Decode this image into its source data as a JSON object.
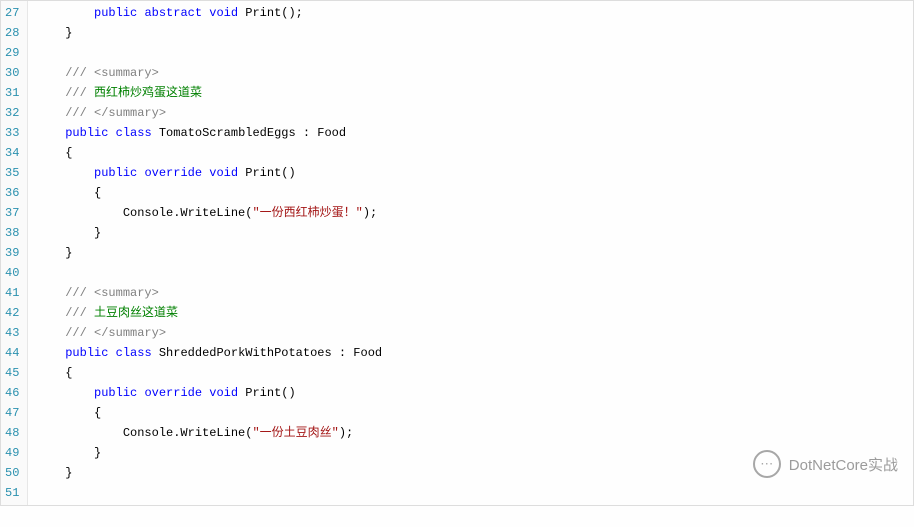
{
  "watermark": {
    "icon": "⋯",
    "text": "DotNetCore实战"
  },
  "lines": [
    {
      "n": 27,
      "segs": [
        {
          "t": "        "
        },
        {
          "t": "public",
          "c": "kw"
        },
        {
          "t": " "
        },
        {
          "t": "abstract",
          "c": "kw"
        },
        {
          "t": " "
        },
        {
          "t": "void",
          "c": "kw"
        },
        {
          "t": " Print();",
          "c": "txt"
        }
      ]
    },
    {
      "n": 28,
      "segs": [
        {
          "t": "    }",
          "c": "txt"
        }
      ]
    },
    {
      "n": 29,
      "segs": [
        {
          "t": " "
        }
      ]
    },
    {
      "n": 30,
      "segs": [
        {
          "t": "    "
        },
        {
          "t": "/// <summary>",
          "c": "com"
        }
      ]
    },
    {
      "n": 31,
      "segs": [
        {
          "t": "    "
        },
        {
          "t": "///",
          "c": "com"
        },
        {
          "t": " 西红柿炒鸡蛋这道菜",
          "c": "grn"
        }
      ]
    },
    {
      "n": 32,
      "segs": [
        {
          "t": "    "
        },
        {
          "t": "/// </summary>",
          "c": "com"
        }
      ]
    },
    {
      "n": 33,
      "segs": [
        {
          "t": "    "
        },
        {
          "t": "public",
          "c": "kw"
        },
        {
          "t": " "
        },
        {
          "t": "class",
          "c": "kw"
        },
        {
          "t": " TomatoScrambledEggs : Food",
          "c": "txt"
        }
      ]
    },
    {
      "n": 34,
      "segs": [
        {
          "t": "    {",
          "c": "txt"
        }
      ]
    },
    {
      "n": 35,
      "segs": [
        {
          "t": "        "
        },
        {
          "t": "public",
          "c": "kw"
        },
        {
          "t": " "
        },
        {
          "t": "override",
          "c": "kw"
        },
        {
          "t": " "
        },
        {
          "t": "void",
          "c": "kw"
        },
        {
          "t": " Print()",
          "c": "txt"
        }
      ]
    },
    {
      "n": 36,
      "segs": [
        {
          "t": "        {",
          "c": "txt"
        }
      ]
    },
    {
      "n": 37,
      "segs": [
        {
          "t": "            Console.WriteLine(",
          "c": "txt"
        },
        {
          "t": "\"一份西红柿炒蛋！\"",
          "c": "str"
        },
        {
          "t": ");",
          "c": "txt"
        }
      ]
    },
    {
      "n": 38,
      "segs": [
        {
          "t": "        }",
          "c": "txt"
        }
      ]
    },
    {
      "n": 39,
      "segs": [
        {
          "t": "    }",
          "c": "txt"
        }
      ]
    },
    {
      "n": 40,
      "segs": [
        {
          "t": " "
        }
      ]
    },
    {
      "n": 41,
      "segs": [
        {
          "t": "    "
        },
        {
          "t": "/// <summary>",
          "c": "com"
        }
      ]
    },
    {
      "n": 42,
      "segs": [
        {
          "t": "    "
        },
        {
          "t": "///",
          "c": "com"
        },
        {
          "t": " 土豆肉丝这道菜",
          "c": "grn"
        }
      ]
    },
    {
      "n": 43,
      "segs": [
        {
          "t": "    "
        },
        {
          "t": "/// </summary>",
          "c": "com"
        }
      ]
    },
    {
      "n": 44,
      "segs": [
        {
          "t": "    "
        },
        {
          "t": "public",
          "c": "kw"
        },
        {
          "t": " "
        },
        {
          "t": "class",
          "c": "kw"
        },
        {
          "t": " ShreddedPorkWithPotatoes : Food",
          "c": "txt"
        }
      ]
    },
    {
      "n": 45,
      "segs": [
        {
          "t": "    {",
          "c": "txt"
        }
      ]
    },
    {
      "n": 46,
      "segs": [
        {
          "t": "        "
        },
        {
          "t": "public",
          "c": "kw"
        },
        {
          "t": " "
        },
        {
          "t": "override",
          "c": "kw"
        },
        {
          "t": " "
        },
        {
          "t": "void",
          "c": "kw"
        },
        {
          "t": " Print()",
          "c": "txt"
        }
      ]
    },
    {
      "n": 47,
      "segs": [
        {
          "t": "        {",
          "c": "txt"
        }
      ]
    },
    {
      "n": 48,
      "segs": [
        {
          "t": "            Console.WriteLine(",
          "c": "txt"
        },
        {
          "t": "\"一份土豆肉丝\"",
          "c": "str"
        },
        {
          "t": ");",
          "c": "txt"
        }
      ]
    },
    {
      "n": 49,
      "segs": [
        {
          "t": "        }",
          "c": "txt"
        }
      ]
    },
    {
      "n": 50,
      "segs": [
        {
          "t": "    }",
          "c": "txt"
        }
      ]
    },
    {
      "n": 51,
      "segs": [
        {
          "t": " "
        }
      ]
    }
  ]
}
